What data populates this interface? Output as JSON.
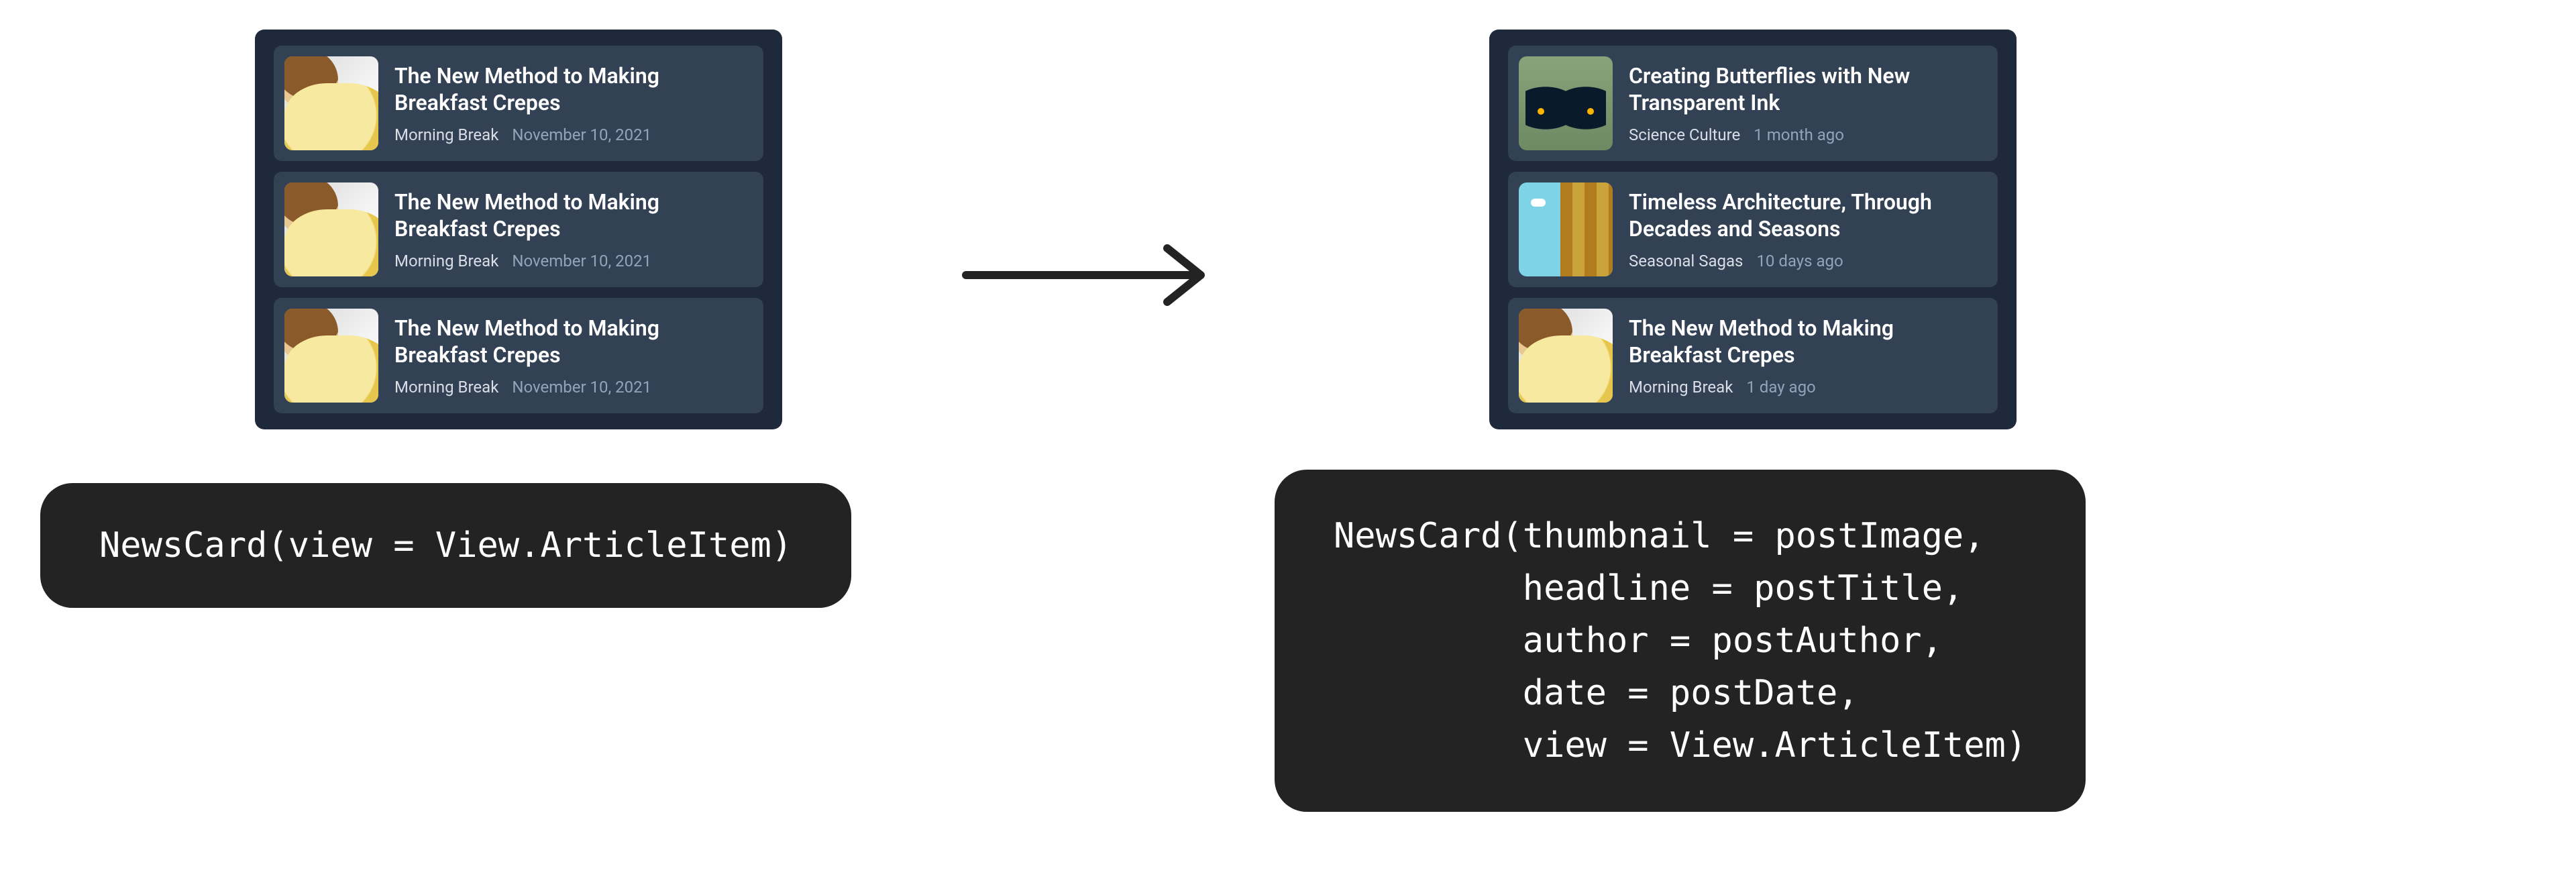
{
  "left": {
    "cards": [
      {
        "title": "The New Method to Making Breakfast Crepes",
        "author": "Morning Break",
        "date": "November 10, 2021",
        "thumb": "crepes"
      },
      {
        "title": "The New Method to Making Breakfast Crepes",
        "author": "Morning Break",
        "date": "November 10, 2021",
        "thumb": "crepes"
      },
      {
        "title": "The New Method to Making Breakfast Crepes",
        "author": "Morning Break",
        "date": "November 10, 2021",
        "thumb": "crepes"
      }
    ],
    "code": "NewsCard(view = View.ArticleItem)"
  },
  "right": {
    "cards": [
      {
        "title": "Creating Butterflies with New Transparent Ink",
        "author": "Science Culture",
        "date": "1 month ago",
        "thumb": "butterfly"
      },
      {
        "title": "Timeless Architecture, Through Decades and Seasons",
        "author": "Seasonal Sagas",
        "date": "10 days ago",
        "thumb": "arch"
      },
      {
        "title": "The New Method to Making Breakfast Crepes",
        "author": "Morning Break",
        "date": "1 day ago",
        "thumb": "crepes"
      }
    ],
    "code": "NewsCard(thumbnail = postImage,\n         headline = postTitle,\n         author = postAuthor,\n         date = postDate,\n         view = View.ArticleItem)"
  }
}
